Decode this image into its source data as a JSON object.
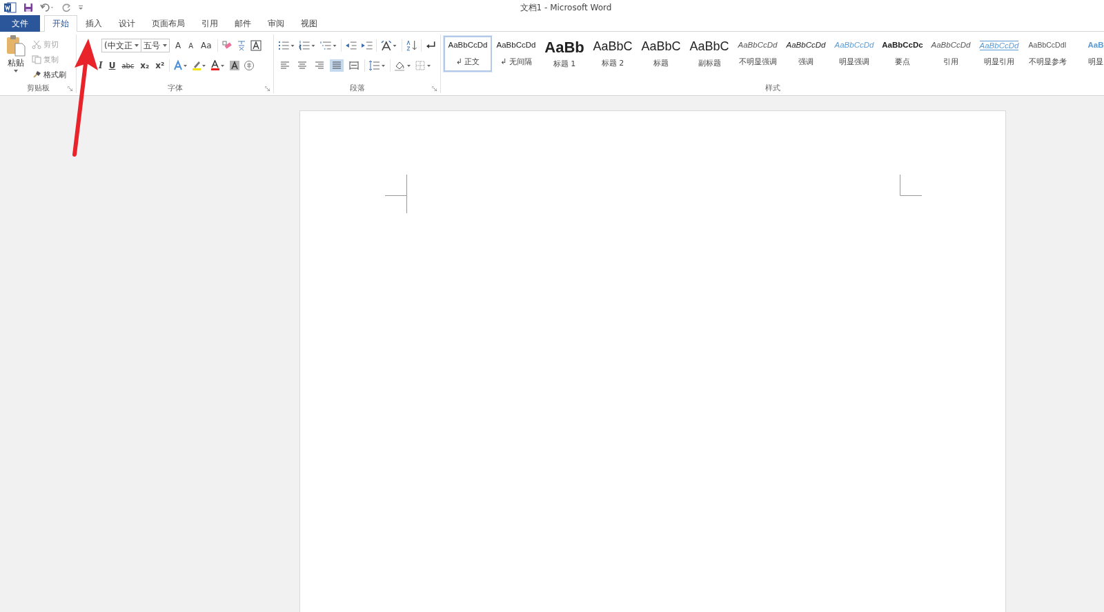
{
  "title_bar": {
    "title": "文档1 - Microsoft Word"
  },
  "tabs": [
    {
      "label": "文件",
      "kind": "file",
      "selected": false
    },
    {
      "label": "开始",
      "kind": "tab",
      "selected": true
    },
    {
      "label": "插入",
      "kind": "tab",
      "selected": false
    },
    {
      "label": "设计",
      "kind": "tab",
      "selected": false
    },
    {
      "label": "页面布局",
      "kind": "tab",
      "selected": false
    },
    {
      "label": "引用",
      "kind": "tab",
      "selected": false
    },
    {
      "label": "邮件",
      "kind": "tab",
      "selected": false
    },
    {
      "label": "审阅",
      "kind": "tab",
      "selected": false
    },
    {
      "label": "视图",
      "kind": "tab",
      "selected": false
    }
  ],
  "clipboard": {
    "paste": "粘贴",
    "actions": [
      {
        "label": "剪切",
        "kind": "cut",
        "disabled": true
      },
      {
        "label": "复制",
        "kind": "copy",
        "disabled": true
      },
      {
        "label": "格式刷",
        "kind": "painter",
        "disabled": false
      }
    ],
    "group_label": "剪贴板"
  },
  "font": {
    "font_name": "(中文正",
    "font_size": "五号",
    "size_buttons": [
      "A",
      "A",
      "Aa"
    ],
    "format_buttons": [
      "I",
      "U",
      "abc",
      "x₂",
      "x²"
    ],
    "group_label": "字体"
  },
  "paragraph": {
    "align_buttons": [
      {
        "selected": false
      },
      {
        "selected": false
      },
      {
        "selected": false
      },
      {
        "selected": true
      },
      {
        "selected": false
      }
    ],
    "group_label": "段落"
  },
  "styles": {
    "items": [
      {
        "preview": "AaBbCcDd",
        "label": "↲ 正文",
        "kind": "normal",
        "selected": true
      },
      {
        "preview": "AaBbCcDd",
        "label": "↲ 无间隔",
        "kind": "normal",
        "selected": false
      },
      {
        "preview": "AaBb",
        "label": "标题 1",
        "kind": "heading1",
        "selected": false
      },
      {
        "preview": "AaBbC",
        "label": "标题 2",
        "kind": "heading",
        "selected": false
      },
      {
        "preview": "AaBbC",
        "label": "标题",
        "kind": "heading",
        "selected": false
      },
      {
        "preview": "AaBbC",
        "label": "副标题",
        "kind": "heading",
        "selected": false
      },
      {
        "preview": "AaBbCcDd",
        "label": "不明显强调",
        "kind": "subtle",
        "selected": false
      },
      {
        "preview": "AaBbCcDd",
        "label": "强调",
        "kind": "italic",
        "selected": false
      },
      {
        "preview": "AaBbCcDd",
        "label": "明显强调",
        "kind": "accent",
        "selected": false
      },
      {
        "preview": "AaBbCcDc",
        "label": "要点",
        "kind": "strong",
        "selected": false
      },
      {
        "preview": "AaBbCcDd",
        "label": "引用",
        "kind": "subtle",
        "selected": false
      },
      {
        "preview": "AaBbCcDd",
        "label": "明显引用",
        "kind": "accent_quote",
        "selected": false
      },
      {
        "preview": "AaBbCcDdI",
        "label": "不明显参考",
        "kind": "smallcaps",
        "selected": false
      },
      {
        "preview": "AaB",
        "label": "明显",
        "kind": "accent_bold",
        "selected": false
      }
    ],
    "group_label": "样式"
  }
}
